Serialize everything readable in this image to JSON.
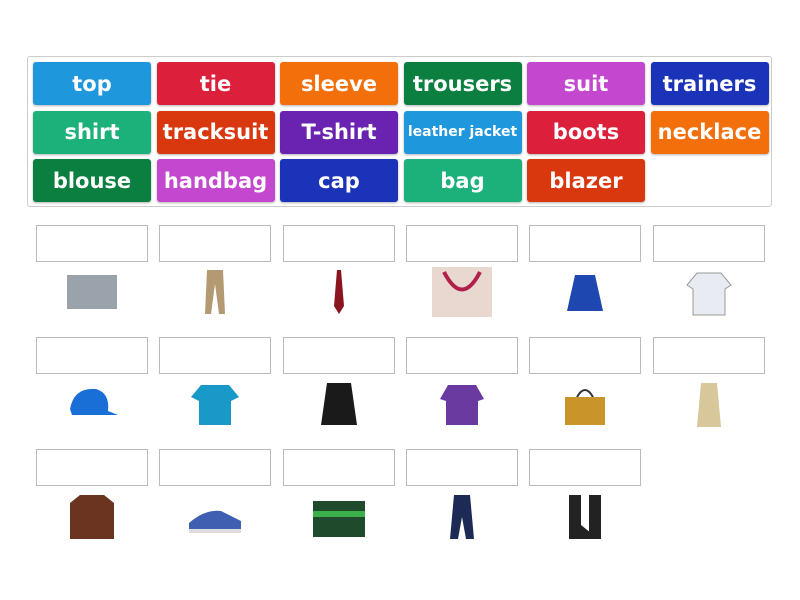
{
  "tiles": [
    {
      "label": "top",
      "color": "#1e97dd"
    },
    {
      "label": "tie",
      "color": "#dc1f3b"
    },
    {
      "label": "sleeve",
      "color": "#f26f0c"
    },
    {
      "label": "trousers",
      "color": "#0a7f3f"
    },
    {
      "label": "suit",
      "color": "#c447cf"
    },
    {
      "label": "trainers",
      "color": "#1b33b8"
    },
    {
      "label": "shirt",
      "color": "#1cb07a"
    },
    {
      "label": "tracksuit",
      "color": "#d9370e"
    },
    {
      "label": "T-shirt",
      "color": "#6a23b0"
    },
    {
      "label": "leather jacket",
      "color": "#1e97dd"
    },
    {
      "label": "boots",
      "color": "#dc1f3b"
    },
    {
      "label": "necklace",
      "color": "#f26f0c"
    },
    {
      "label": "blouse",
      "color": "#0a7f3f"
    },
    {
      "label": "handbag",
      "color": "#c447cf"
    },
    {
      "label": "cap",
      "color": "#1b33b8"
    },
    {
      "label": "bag",
      "color": "#1cb07a"
    },
    {
      "label": "blazer",
      "color": "#d9370e"
    }
  ],
  "pictures": [
    {
      "icon": "sleeve-image",
      "color": "#9aa3ab"
    },
    {
      "icon": "trousers-image",
      "color": "#b49a72"
    },
    {
      "icon": "tie-image",
      "color": "#8c1420"
    },
    {
      "icon": "necklace-image",
      "color": "#b0204a"
    },
    {
      "icon": "blazer-image",
      "color": "#1f47b0"
    },
    {
      "icon": "shirt-image",
      "color": "#e8ecf2"
    },
    {
      "icon": "cap-image",
      "color": "#1a6fd6"
    },
    {
      "icon": "t-shirt-image",
      "color": "#1899c8"
    },
    {
      "icon": "tracksuit-image",
      "color": "#1a1a1a"
    },
    {
      "icon": "blouse-image",
      "color": "#6b3aa0"
    },
    {
      "icon": "handbag-image",
      "color": "#c9952a"
    },
    {
      "icon": "top-image",
      "color": "#d8c79a"
    },
    {
      "icon": "leather-jacket-image",
      "color": "#6b3420"
    },
    {
      "icon": "trainers-image",
      "color": "#3f5fb0"
    },
    {
      "icon": "bag-image",
      "color": "#1f4a2c"
    },
    {
      "icon": "suit-image",
      "color": "#1c2a55"
    },
    {
      "icon": "boots-image",
      "color": "#222222"
    }
  ]
}
